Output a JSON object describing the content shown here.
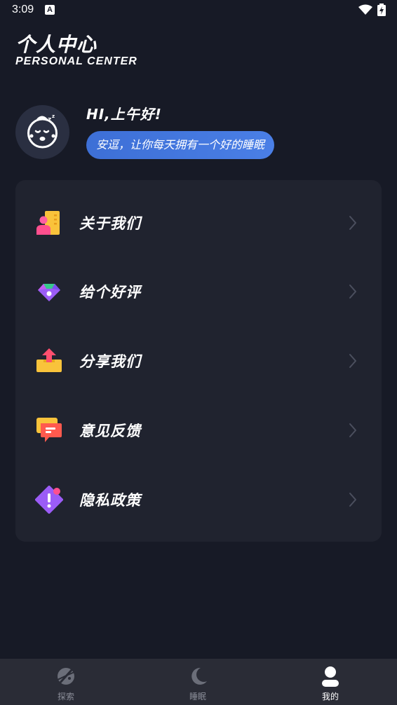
{
  "status_bar": {
    "time": "3:09",
    "notification_glyph": "A"
  },
  "header": {
    "title": "个人中心",
    "subtitle": "PERSONAL CENTER"
  },
  "profile": {
    "greeting": "HI,上午好!",
    "motto": "安逗，让你每天拥有一个好的睡眠"
  },
  "menu": {
    "items": [
      {
        "label": "关于我们",
        "icon": "about-icon"
      },
      {
        "label": "给个好评",
        "icon": "rate-icon"
      },
      {
        "label": "分享我们",
        "icon": "share-icon"
      },
      {
        "label": "意见反馈",
        "icon": "feedback-icon"
      },
      {
        "label": "隐私政策",
        "icon": "privacy-icon"
      }
    ]
  },
  "bottom_nav": {
    "items": [
      {
        "label": "探索",
        "icon": "explore-icon",
        "active": false
      },
      {
        "label": "睡眠",
        "icon": "moon-icon",
        "active": false
      },
      {
        "label": "我的",
        "icon": "profile-icon",
        "active": true
      }
    ]
  },
  "colors": {
    "background": "#171a26",
    "card": "#20232f",
    "accent": "#3d6fd6",
    "nav_background": "#2a2c36"
  }
}
